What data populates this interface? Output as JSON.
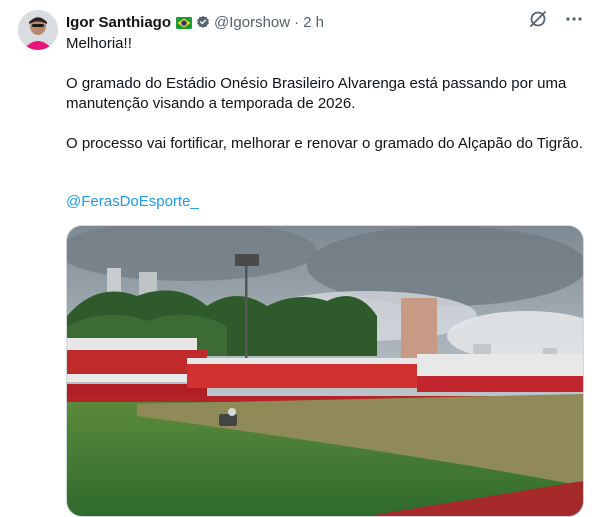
{
  "author": {
    "display_name": "Igor Santhiago",
    "handle": "@Igorshow",
    "timestamp": "2 h",
    "flag_icon": "brazil-flag-icon",
    "verified_icon": "verified-badge-icon"
  },
  "header_actions": {
    "grok_icon": "grok-icon",
    "more_icon": "more-options-icon"
  },
  "post": {
    "line1": "Melhoria!!",
    "paragraph2": "O gramado do Estádio Onésio Brasileiro Alvarenga está passando por uma manutenção visando a temporada de 2026.",
    "paragraph3": "O processo vai fortificar, melhorar e renovar o gramado do Alçapão do Tigrão.",
    "mention": "@FerasDoEsporte_"
  },
  "colors": {
    "accent": "#1d9bf0",
    "text": "#0f1419",
    "secondary": "#536471",
    "border": "#cfd9de"
  }
}
